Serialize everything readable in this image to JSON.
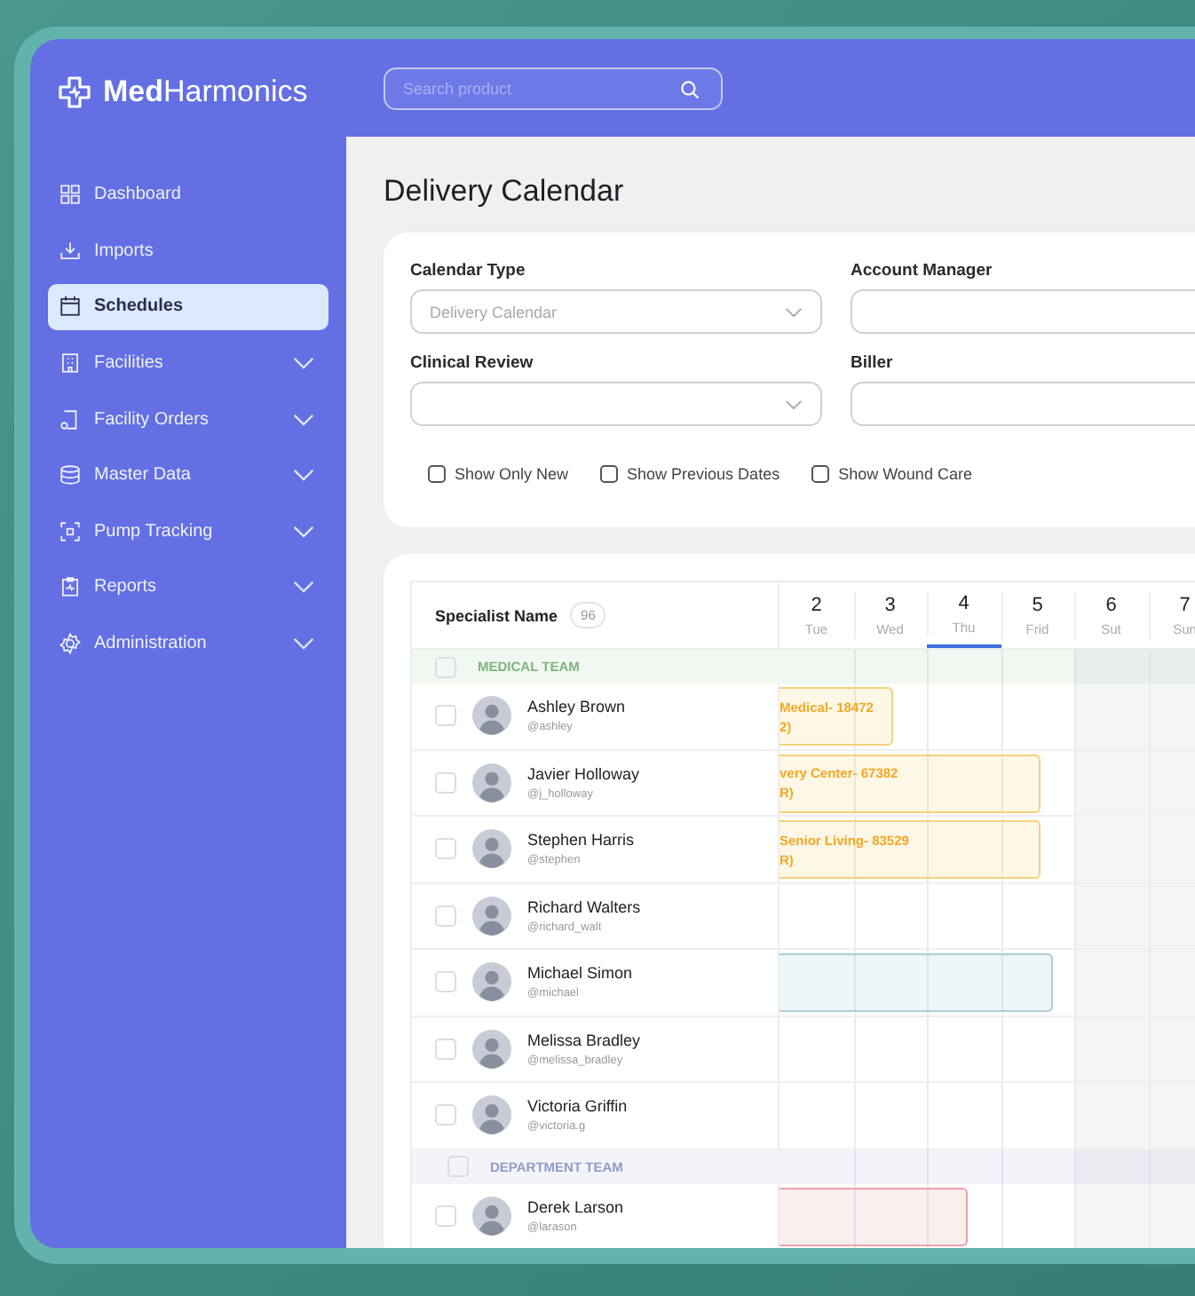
{
  "brand": {
    "name": "**Med**Harmonics"
  },
  "search": {
    "placeholder": "Search product"
  },
  "sidebar": {
    "items": [
      {
        "label": "Dashboard",
        "has_submenu": false,
        "selected": false
      },
      {
        "label": "Imports",
        "has_submenu": false,
        "selected": false
      },
      {
        "label": "Schedules",
        "has_submenu": false,
        "selected": true
      },
      {
        "label": "Facilities",
        "has_submenu": true,
        "selected": false
      },
      {
        "label": "Facility Orders",
        "has_submenu": true,
        "selected": false
      },
      {
        "label": "Master Data",
        "has_submenu": true,
        "selected": false
      },
      {
        "label": "Pump Tracking",
        "has_submenu": true,
        "selected": false
      },
      {
        "label": "Reports",
        "has_submenu": true,
        "selected": false
      },
      {
        "label": "Administration",
        "has_submenu": true,
        "selected": false
      }
    ]
  },
  "page": {
    "title": "Delivery Calendar"
  },
  "filters": {
    "fields": [
      {
        "label": "Calendar Type",
        "kind": "select",
        "value": "Delivery Calendar"
      },
      {
        "label": "Account Manager",
        "kind": "text"
      },
      {
        "label": "Clinical Review",
        "kind": "select"
      },
      {
        "label": "Biller",
        "kind": "text"
      }
    ],
    "checkboxes": [
      {
        "label": "Show Only New",
        "checked": false
      },
      {
        "label": "Show Previous Dates",
        "checked": false
      },
      {
        "label": "Show Wound Care",
        "checked": false
      }
    ]
  },
  "calendar": {
    "column_header": "Specialist Name",
    "count": "96",
    "days": [
      {
        "date": "2",
        "weekday": "Tue",
        "selected": false,
        "weekend": false
      },
      {
        "date": "3",
        "weekday": "Wed",
        "selected": false,
        "weekend": false
      },
      {
        "date": "4",
        "weekday": "Thu",
        "selected": true,
        "weekend": false
      },
      {
        "date": "5",
        "weekday": "Frid",
        "selected": false,
        "weekend": false
      },
      {
        "date": "6",
        "weekday": "Sut",
        "selected": false,
        "weekend": true
      },
      {
        "date": "7",
        "weekday": "Sun",
        "selected": false,
        "weekend": true
      }
    ],
    "groups": [
      {
        "name": "MEDICAL TEAM",
        "color": "#7fb47f",
        "checked": false,
        "specialists": [
          {
            "name": "Ashley Brown",
            "handle": "@ashley",
            "checked": false,
            "event": {
              "title": "Medical- 18472",
              "detail": "2)",
              "color": "#f5d27a"
            }
          },
          {
            "name": "Javier Holloway",
            "handle": "@j_holloway",
            "checked": false,
            "event": {
              "title": "very Center- 67382",
              "detail": "R)",
              "color": "#f5d27a"
            }
          },
          {
            "name": "Stephen Harris",
            "handle": "@stephen",
            "checked": false,
            "event": {
              "title": "Senior Living- 83529",
              "detail": "R)",
              "color": "#f5d27a"
            }
          },
          {
            "name": "Richard Walters",
            "handle": "@richard_walt",
            "checked": false
          },
          {
            "name": "Michael Simon",
            "handle": "@michael",
            "checked": false,
            "event": {
              "color": "#a9cfd8"
            }
          },
          {
            "name": "Melissa Bradley",
            "handle": "@melissa_bradley",
            "checked": false
          },
          {
            "name": "Victoria Griffin",
            "handle": "@victoria.g",
            "checked": false
          }
        ]
      },
      {
        "name": "DEPARTMENT TEAM",
        "color": "#8f9cc8",
        "checked": false,
        "specialists": [
          {
            "name": "Derek Larson",
            "handle": "@larason",
            "checked": false,
            "event": {
              "color": "#eba3a9"
            }
          }
        ]
      }
    ]
  }
}
